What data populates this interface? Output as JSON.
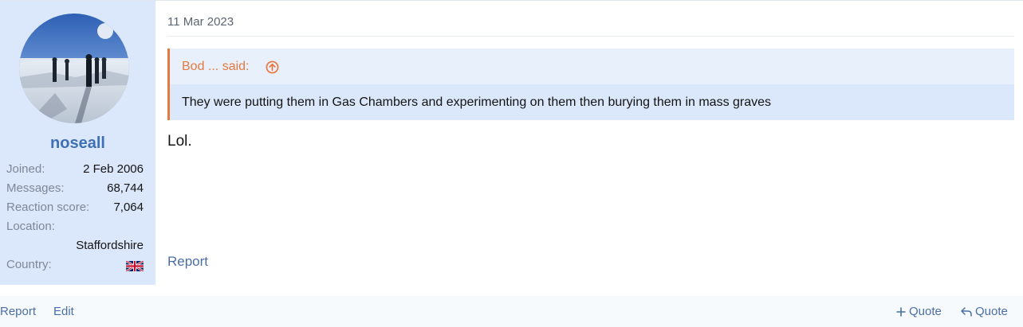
{
  "post": {
    "date": "11 Mar 2023",
    "quote": {
      "author_said": "Bod ... said:",
      "text": "They were putting them in Gas Chambers and experimenting on them then burying them in mass graves"
    },
    "message": "Lol.",
    "report_label": "Report"
  },
  "user": {
    "username": "noseall",
    "info": [
      {
        "label": "Joined:",
        "value": "2 Feb 2006"
      },
      {
        "label": "Messages:",
        "value": "68,744"
      },
      {
        "label": "Reaction score:",
        "value": "7,064"
      },
      {
        "label": "Location:",
        "value": ""
      },
      {
        "label": "",
        "value": "Staffordshire"
      },
      {
        "label": "Country:",
        "value": ""
      }
    ],
    "country_flag": "uk-flag-icon"
  },
  "actions": {
    "report": "Report",
    "edit": "Edit",
    "multi_quote": "Quote",
    "quote": "Quote"
  },
  "colors": {
    "accent_link": "#4a6fa5",
    "quote_accent": "#e5793f",
    "user_panel": "#dbe7fa",
    "username": "#3f6fb5"
  }
}
